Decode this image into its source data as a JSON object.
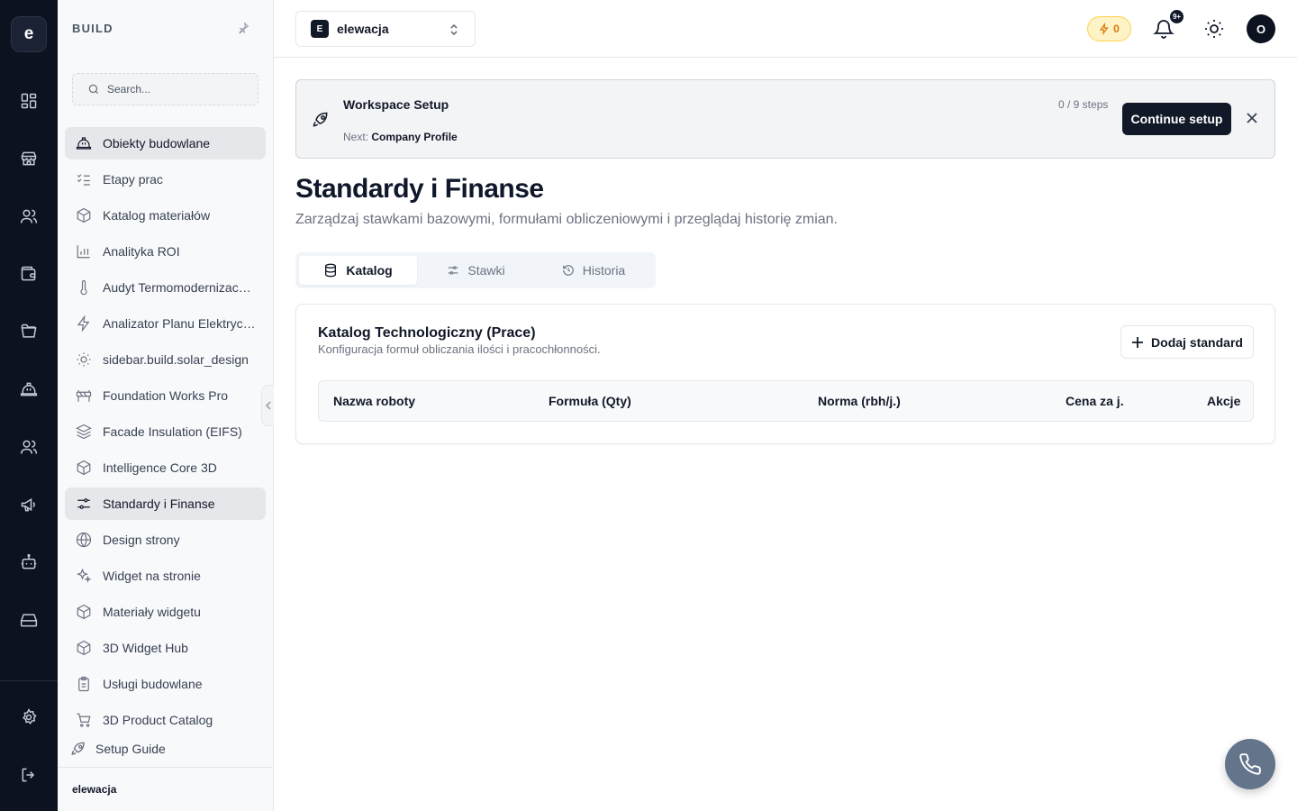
{
  "rail": {
    "logo": "e",
    "items": [
      {
        "icon": "dashboard-icon"
      },
      {
        "icon": "store-icon"
      },
      {
        "icon": "users-icon"
      },
      {
        "icon": "wallet-icon"
      },
      {
        "icon": "folder-icon"
      },
      {
        "icon": "hard-hat-icon"
      },
      {
        "icon": "team-icon"
      },
      {
        "icon": "megaphone-icon"
      },
      {
        "icon": "bot-icon"
      },
      {
        "icon": "drive-icon"
      }
    ],
    "bottom": [
      {
        "icon": "settings-icon"
      },
      {
        "icon": "logout-icon"
      }
    ]
  },
  "sidebar": {
    "heading": "BUILD",
    "search_placeholder": "Search...",
    "items": [
      {
        "label": "Obiekty budowlane",
        "icon": "hard-hat-icon",
        "active": true
      },
      {
        "label": "Etapy prac",
        "icon": "checklist-icon"
      },
      {
        "label": "Katalog materiałów",
        "icon": "box-icon"
      },
      {
        "label": "Analityka ROI",
        "icon": "bar-chart-icon"
      },
      {
        "label": "Audyt Termomodernizacyjny",
        "icon": "thermometer-icon"
      },
      {
        "label": "Analizator Planu Elektrycznego",
        "icon": "lightning-icon"
      },
      {
        "label": "sidebar.build.solar_design",
        "icon": "sun-icon"
      },
      {
        "label": "Foundation Works Pro",
        "icon": "barrier-icon"
      },
      {
        "label": "Facade Insulation (EIFS)",
        "icon": "layers-icon"
      },
      {
        "label": "Intelligence Core 3D",
        "icon": "box-icon"
      },
      {
        "label": "Standardy i Finanse",
        "icon": "sliders-icon",
        "active": true
      },
      {
        "label": "Design strony",
        "icon": "globe-icon"
      },
      {
        "label": "Widget na stronie",
        "icon": "sparkles-icon"
      },
      {
        "label": "Materiały widgetu",
        "icon": "box-icon"
      },
      {
        "label": "3D Widget Hub",
        "icon": "box-icon"
      },
      {
        "label": "Usługi budowlane",
        "icon": "clipboard-icon"
      },
      {
        "label": "3D Product Catalog",
        "icon": "cart-icon"
      }
    ],
    "setup_guide": "Setup Guide",
    "footer_workspace": "elewacja"
  },
  "header": {
    "workspace_badge": "E",
    "workspace_name": "elewacja",
    "credits": "0",
    "notifications_badge": "9+",
    "avatar_initial": "O"
  },
  "banner": {
    "title": "Workspace Setup",
    "next_prefix": "Next:",
    "next_step": "Company Profile",
    "steps": "0 / 9 steps",
    "button": "Continue setup"
  },
  "page": {
    "title": "Standardy i Finanse",
    "subtitle": "Zarządzaj stawkami bazowymi, formułami obliczeniowymi i przeglądaj historię zmian."
  },
  "tabs": [
    {
      "label": "Katalog",
      "icon": "database-icon",
      "active": true
    },
    {
      "label": "Stawki",
      "icon": "sliders-icon"
    },
    {
      "label": "Historia",
      "icon": "history-icon"
    }
  ],
  "catalog": {
    "title": "Katalog Technologiczny (Prace)",
    "subtitle": "Konfiguracja formuł obliczania ilości i pracochłonności.",
    "add_button": "Dodaj standard",
    "columns": [
      "Nazwa roboty",
      "Formuła (Qty)",
      "Norma (rbh/j.)",
      "Cena za j.",
      "Akcje"
    ]
  },
  "colors": {
    "rail_bg": "#0c1220",
    "primary": "#111827",
    "credits_bg": "#fef3c7",
    "credits_fg": "#d97706",
    "fab": "#64748b"
  }
}
